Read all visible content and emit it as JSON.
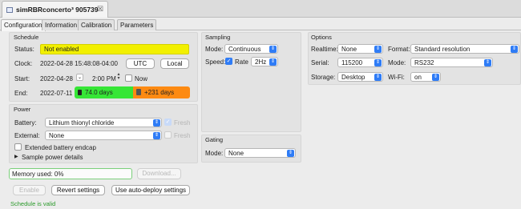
{
  "editor_tab": {
    "title": "simRBRconcerto³ 905739",
    "close": "☒"
  },
  "tabs": [
    {
      "label": "Configuration",
      "active": true
    },
    {
      "label": "Information",
      "active": false
    },
    {
      "label": "Calibration",
      "active": false
    },
    {
      "label": "Parameters",
      "active": false
    }
  ],
  "schedule": {
    "title": "Schedule",
    "status_label": "Status:",
    "status_value": "Not enabled",
    "clock_label": "Clock:",
    "clock_value": "2022-04-28 15:48:08-04:00",
    "utc_button": "UTC",
    "local_button": "Local",
    "start_label": "Start:",
    "start_date": "2022-04-28",
    "start_time": "2:00 PM",
    "now_label": "Now",
    "end_label": "End:",
    "end_date": "2022-07-11",
    "duration_days": "74.0 days",
    "extra_days": "+231 days"
  },
  "power": {
    "title": "Power",
    "battery_label": "Battery:",
    "battery_value": "Lithium thionyl chloride",
    "external_label": "External:",
    "external_value": "None",
    "fresh_label": "Fresh",
    "extended_label": "Extended battery endcap",
    "sample_details_label": "Sample power details"
  },
  "sampling": {
    "title": "Sampling",
    "mode_label": "Mode:",
    "mode_value": "Continuous",
    "speed_label": "Speed:",
    "rate_label": "Rate",
    "rate_value": "2Hz"
  },
  "gating": {
    "title": "Gating",
    "mode_label": "Mode:",
    "mode_value": "None"
  },
  "options": {
    "title": "Options",
    "realtime_label": "Realtime:",
    "realtime_value": "None",
    "format_label": "Format:",
    "format_value": "Standard resolution",
    "serial_label": "Serial:",
    "serial_value": "115200",
    "mode_label": "Mode:",
    "mode_value": "RS232",
    "storage_label": "Storage:",
    "storage_value": "Desktop",
    "wifi_label": "Wi-Fi:",
    "wifi_value": "on"
  },
  "memory": {
    "label": "Memory used: 0%",
    "download_button": "Download..."
  },
  "actions": {
    "enable": "Enable",
    "revert": "Revert settings",
    "auto_deploy": "Use auto-deploy settings"
  },
  "validation": "Schedule is valid",
  "colors": {
    "status_yellow": "#f2f000",
    "duration_green": "#36e636",
    "extra_orange": "#fd8a12",
    "valid_green": "#2a9a2a",
    "accent_blue": "#2f7cf6"
  }
}
